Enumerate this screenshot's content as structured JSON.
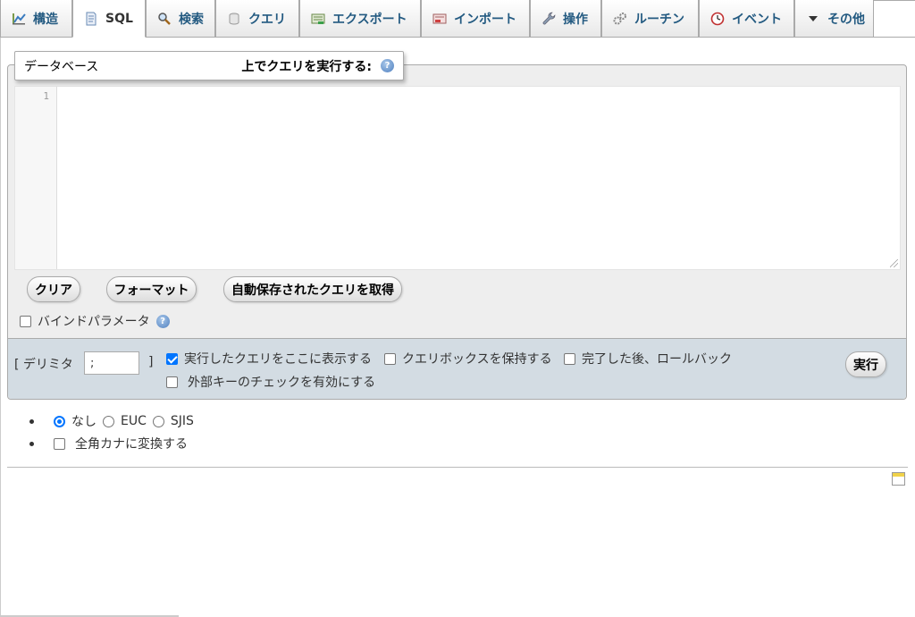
{
  "tabs": [
    {
      "label": "構造",
      "icon": "structure-icon"
    },
    {
      "label": "SQL",
      "icon": "sql-icon"
    },
    {
      "label": "検索",
      "icon": "search-icon"
    },
    {
      "label": "クエリ",
      "icon": "query-icon"
    },
    {
      "label": "エクスポート",
      "icon": "export-icon"
    },
    {
      "label": "インポート",
      "icon": "import-icon"
    },
    {
      "label": "操作",
      "icon": "wrench-icon"
    },
    {
      "label": "ルーチン",
      "icon": "routines-icon"
    },
    {
      "label": "イベント",
      "icon": "events-clock-icon"
    },
    {
      "label": "その他",
      "icon": "triangle-down-icon"
    }
  ],
  "active_tab": "SQL",
  "legend": {
    "left": "データベース",
    "right": "上でクエリを実行する:"
  },
  "editor": {
    "line_number": "1",
    "content": ""
  },
  "buttons": {
    "clear": "クリア",
    "format": "フォーマット",
    "get_autosaved": "自動保存されたクエリを取得",
    "go": "実行"
  },
  "bind_params": {
    "label": "バインドパラメータ",
    "checked": false
  },
  "footer": {
    "delimiter_label": "[ デリミタ",
    "delimiter_close": "]",
    "delimiter_value": ";",
    "show_query": {
      "label": "実行したクエリをここに表示する",
      "checked": true
    },
    "retain_box": {
      "label": "クエリボックスを保持する",
      "checked": false
    },
    "rollback": {
      "label": "完了した後、ロールバック",
      "checked": false
    },
    "fk_checks": {
      "label": "外部キーのチェックを有効にする",
      "checked": false
    }
  },
  "encoding": {
    "options": [
      {
        "label": "なし",
        "checked": true
      },
      {
        "label": "EUC",
        "checked": false
      },
      {
        "label": "SJIS",
        "checked": false
      }
    ],
    "kana": {
      "label": "全角カナに変換する",
      "checked": false
    }
  },
  "colors": {
    "panel_bg": "#eeeeee",
    "footer_bg": "#d3dce3",
    "tab_text": "#235a81",
    "accent": "#0075ff"
  }
}
